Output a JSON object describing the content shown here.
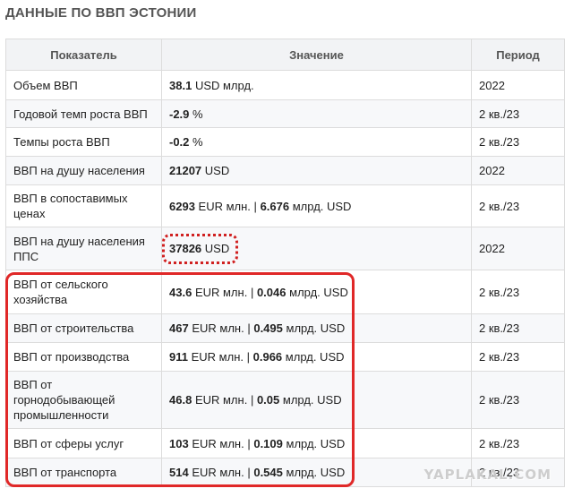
{
  "title": "ДАННЫЕ ПО ВВП ЭСТОНИИ",
  "columns": {
    "indicator": "Показатель",
    "value": "Значение",
    "period": "Период"
  },
  "rows": [
    {
      "label": "Объем ВВП",
      "num1": "38.1",
      "unit1": "USD млрд.",
      "sep": "",
      "num2": "",
      "unit2": "",
      "period": "2022"
    },
    {
      "label": "Годовой темп роста ВВП",
      "num1": "-2.9",
      "unit1": "%",
      "sep": "",
      "num2": "",
      "unit2": "",
      "period": "2 кв./23"
    },
    {
      "label": "Темпы роста ВВП",
      "num1": "-0.2",
      "unit1": "%",
      "sep": "",
      "num2": "",
      "unit2": "",
      "period": "2 кв./23"
    },
    {
      "label": "ВВП на душу населения",
      "num1": "21207",
      "unit1": "USD",
      "sep": "",
      "num2": "",
      "unit2": "",
      "period": "2022"
    },
    {
      "label": "ВВП в сопоставимых ценах",
      "num1": "6293",
      "unit1": "EUR млн.",
      "sep": "|",
      "num2": "6.676",
      "unit2": "млрд. USD",
      "period": "2 кв./23"
    },
    {
      "label": "ВВП на душу населения ППС",
      "num1": "37826",
      "unit1": "USD",
      "sep": "",
      "num2": "",
      "unit2": "",
      "period": "2022"
    },
    {
      "label": "ВВП от сельского хозяйства",
      "num1": "43.6",
      "unit1": "EUR млн.",
      "sep": "|",
      "num2": "0.046",
      "unit2": "млрд. USD",
      "period": "2 кв./23"
    },
    {
      "label": "ВВП от строительства",
      "num1": "467",
      "unit1": "EUR млн.",
      "sep": "|",
      "num2": "0.495",
      "unit2": "млрд. USD",
      "period": "2 кв./23"
    },
    {
      "label": "ВВП от производства",
      "num1": "911",
      "unit1": "EUR млн.",
      "sep": "|",
      "num2": "0.966",
      "unit2": "млрд. USD",
      "period": "2 кв./23"
    },
    {
      "label": "ВВП от горнодобывающей промышленности",
      "num1": "46.8",
      "unit1": "EUR млн.",
      "sep": "|",
      "num2": "0.05",
      "unit2": "млрд. USD",
      "period": "2 кв./23"
    },
    {
      "label": "ВВП от сферы услуг",
      "num1": "103",
      "unit1": "EUR млн.",
      "sep": "|",
      "num2": "0.109",
      "unit2": "млрд. USD",
      "period": "2 кв./23"
    },
    {
      "label": "ВВП от транспорта",
      "num1": "514",
      "unit1": "EUR млн.",
      "sep": "|",
      "num2": "0.545",
      "unit2": "млрд. USD",
      "period": "2 кв./23"
    }
  ],
  "watermark": "YAPLAKAL.COM"
}
